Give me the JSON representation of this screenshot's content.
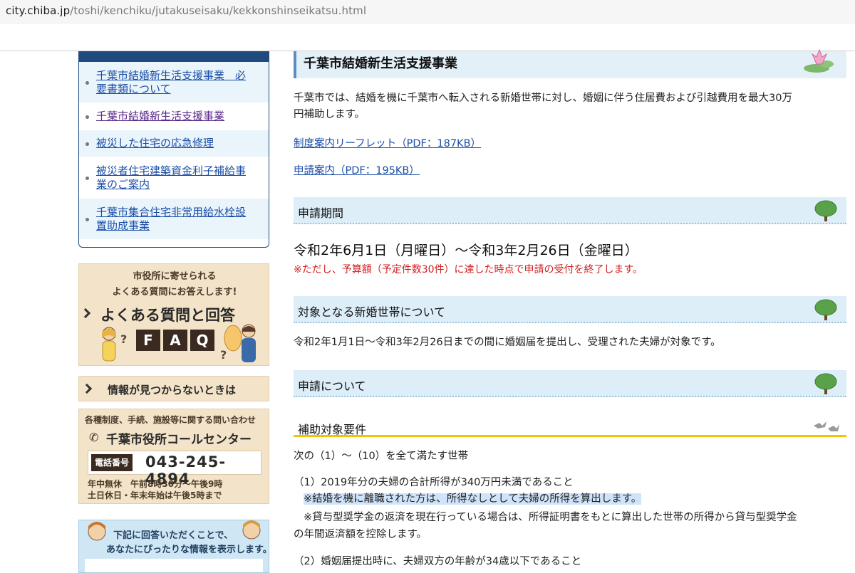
{
  "browser": {
    "url_domain": "city.chiba.jp",
    "url_path": "/toshi/kenchiku/jutakuseisaku/kekkonshinseikatsu.html"
  },
  "sidebar": {
    "nav_items": [
      {
        "label_line1": "千葉市結婚新生活支援事業　必",
        "label_line2": "要書類について"
      },
      {
        "label_line1": "千葉市結婚新生活支援事業",
        "label_line2": ""
      },
      {
        "label_line1": "被災した住宅の応急修理",
        "label_line2": ""
      },
      {
        "label_line1": "被災者住宅建築資金利子補給事",
        "label_line2": "業のご案内"
      },
      {
        "label_line1": "千葉市集合住宅非常用給水栓設",
        "label_line2": "置助成事業"
      }
    ],
    "faq_banner": {
      "line1": "市役所に寄せられる",
      "line2": "よくある質問にお答えします!",
      "title": "よくある質問と回答",
      "tiles": [
        "F",
        "A",
        "Q"
      ]
    },
    "notfound_banner": {
      "label": "情報が見つからないときは"
    },
    "call_center": {
      "intro": "各種制度、手続、施設等に関する問い合わせ",
      "name": "千葉市役所コールセンター",
      "tag": "電話番号",
      "number": "043-245-4894",
      "hours1": "年中無休　午前8時30分～午後9時",
      "hours2": "土日休日・年末年始は午後5時まで"
    },
    "quiz_banner": {
      "line1": "下記に回答いただくことで、",
      "line2": "あなたにぴったりな情報を表示します。"
    }
  },
  "main": {
    "page_title": "千葉市結婚新生活支援事業",
    "intro_line1": "千葉市では、結婚を機に千葉市へ転入される新婚世帯に対し、婚姻に伴う住居費および引越費用を最大30万",
    "intro_line2": "円補助します。",
    "link_leaflet": "制度案内リーフレット（PDF：187KB）",
    "link_guide": "申請案内（PDF：195KB）",
    "section_period": {
      "heading": "申請期間",
      "dates": "令和2年6月1日（月曜日）～令和3年2月26日（金曜日）",
      "note": "※ただし、予算額（予定件数30件）に達した時点で申請の受付を終了します。"
    },
    "section_target": {
      "heading": "対象となる新婚世帯について",
      "text": "令和2年1月1日～令和3年2月26日までの間に婚姻届を提出し、受理された夫婦が対象です。"
    },
    "section_apply": {
      "heading": "申請について"
    },
    "section_requirements": {
      "heading": "補助対象要件",
      "lead": "次の（1）～（10）を全て満たす世帯",
      "item1": "（1）2019年分の夫婦の合計所得が340万円未満であること",
      "item1_note1": "※結婚を機に離職された方は、所得なしとして夫婦の所得を算出します。",
      "item1_note2_line1": "※貸与型奨学金の返済を現在行っている場合は、所得証明書をもとに算出した世帯の所得から貸与型奨学金",
      "item1_note2_line2": "の年間返済額を控除します。",
      "item2": "（2）婚姻届提出時に、夫婦双方の年齢が34歳以下であること"
    }
  },
  "colors": {
    "nav_border": "#1e4a7e",
    "link": "#1a4ea8",
    "heading_bg": "#ddeef9",
    "note_red": "#d21e1e",
    "h3_underline": "#f0c400"
  }
}
